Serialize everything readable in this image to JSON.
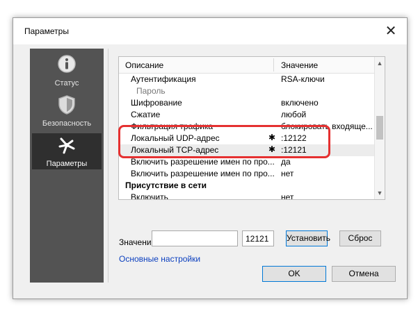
{
  "window": {
    "title": "Параметры",
    "close_glyph": "✕"
  },
  "sidebar": {
    "items": [
      {
        "label": "Статус",
        "icon": "info-icon"
      },
      {
        "label": "Безопасность",
        "icon": "shield-icon"
      },
      {
        "label": "Параметры",
        "icon": "settings-icon"
      }
    ],
    "active_index": 2
  },
  "grid": {
    "columns": [
      "Описание",
      "Значение"
    ],
    "rows": [
      {
        "name": "Аутентификация",
        "value": "RSA-ключи",
        "star": "",
        "indent": "normal"
      },
      {
        "name": "Пароль",
        "value": "",
        "star": "",
        "indent": "sub"
      },
      {
        "name": "Шифрование",
        "value": "включено",
        "star": "",
        "indent": "normal"
      },
      {
        "name": "Сжатие",
        "value": "любой",
        "star": "",
        "indent": "normal"
      },
      {
        "name": "Фильтрация трафика",
        "value": "блокировать входяще...",
        "star": "",
        "indent": "normal"
      },
      {
        "name": "Локальный UDP-адрес",
        "value": ":12122",
        "star": "✱",
        "indent": "normal"
      },
      {
        "name": "Локальный TCP-адрес",
        "value": ":12121",
        "star": "✱",
        "indent": "normal",
        "selected": true
      },
      {
        "name": "Включить разрешение имен по про...",
        "value": "да",
        "star": "",
        "indent": "normal"
      },
      {
        "name": "Включить разрешение имен по про...",
        "value": "нет",
        "star": "",
        "indent": "normal"
      },
      {
        "name": "Присутствие в сети",
        "value": "",
        "star": "",
        "indent": "header"
      },
      {
        "name": "Включить",
        "value": "нет",
        "star": "",
        "indent": "normal"
      }
    ]
  },
  "editor": {
    "value_label": "Значение",
    "value_field": "",
    "port_field": "12121",
    "set_button": "Установить",
    "reset_button": "Сброс"
  },
  "basic_settings_link": "Основные настройки",
  "footer": {
    "ok": "OK",
    "cancel": "Отмена"
  }
}
